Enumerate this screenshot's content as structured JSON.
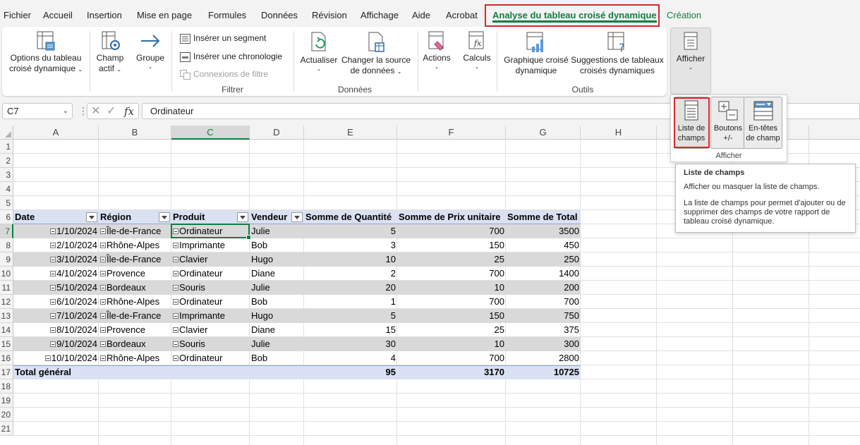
{
  "menu": {
    "tabs": [
      "Fichier",
      "Accueil",
      "Insertion",
      "Mise en page",
      "Formules",
      "Données",
      "Révision",
      "Affichage",
      "Aide",
      "Acrobat"
    ],
    "active_tab": "Analyse du tableau croisé dynamique",
    "extra_tab": "Création"
  },
  "ribbon": {
    "pivot_options_1": "Options du tableau",
    "pivot_options_2": "croisé dynamique",
    "active_field_1": "Champ",
    "active_field_2": "actif",
    "group": "Groupe",
    "insert_slicer": "Insérer un segment",
    "insert_timeline": "Insérer une chronologie",
    "filter_connections": "Connexions de filtre",
    "group_filter": "Filtrer",
    "refresh": "Actualiser",
    "change_source_1": "Changer la source",
    "change_source_2": "de données",
    "group_data": "Données",
    "actions": "Actions",
    "calculations": "Calculs",
    "pivot_chart_1": "Graphique croisé",
    "pivot_chart_2": "dynamique",
    "suggestions_1": "Suggestions de tableaux",
    "suggestions_2": "croisés dynamiques",
    "group_tools": "Outils",
    "show": "Afficher"
  },
  "show_dropdown": {
    "field_list_1": "Liste de",
    "field_list_2": "champs",
    "buttons_1": "Boutons",
    "buttons_2": "+/-",
    "headers_1": "En-têtes",
    "headers_2": "de champ",
    "group_label": "Afficher"
  },
  "tooltip": {
    "title": "Liste de champs",
    "line1": "Afficher ou masquer la liste de champs.",
    "line2": "La liste de champs pour permet d'ajouter ou de supprimer des champs de votre rapport de tableau croisé dynamique."
  },
  "formula_bar": {
    "name_box": "C7",
    "cancel": "✕",
    "enter": "✓",
    "fx": "fx",
    "content": "Ordinateur"
  },
  "sheet": {
    "columns": [
      "A",
      "B",
      "C",
      "D",
      "E",
      "F",
      "G",
      "H"
    ],
    "selected_column": "C",
    "rows": [
      "1",
      "2",
      "3",
      "4",
      "5",
      "6",
      "7",
      "8",
      "9",
      "10",
      "11",
      "12",
      "13",
      "14",
      "15",
      "16",
      "17",
      "18",
      "19",
      "20",
      "21"
    ],
    "selected_row": "7",
    "headers": [
      "Date",
      "Région",
      "Produit",
      "Vendeur",
      "Somme de Quantité",
      "Somme de Prix unitaire",
      "Somme de Total"
    ],
    "data": [
      [
        "1/10/2024",
        "Île-de-France",
        "Ordinateur",
        "Julie",
        "5",
        "700",
        "3500"
      ],
      [
        "2/10/2024",
        "Rhône-Alpes",
        "Imprimante",
        "Bob",
        "3",
        "150",
        "450"
      ],
      [
        "3/10/2024",
        "Île-de-France",
        "Clavier",
        "Hugo",
        "10",
        "25",
        "250"
      ],
      [
        "4/10/2024",
        "Provence",
        "Ordinateur",
        "Diane",
        "2",
        "700",
        "1400"
      ],
      [
        "5/10/2024",
        "Bordeaux",
        "Souris",
        "Julie",
        "20",
        "10",
        "200"
      ],
      [
        "6/10/2024",
        "Rhône-Alpes",
        "Ordinateur",
        "Bob",
        "1",
        "700",
        "700"
      ],
      [
        "7/10/2024",
        "Île-de-France",
        "Imprimante",
        "Hugo",
        "5",
        "150",
        "750"
      ],
      [
        "8/10/2024",
        "Provence",
        "Clavier",
        "Diane",
        "15",
        "25",
        "375"
      ],
      [
        "9/10/2024",
        "Bordeaux",
        "Souris",
        "Julie",
        "30",
        "10",
        "300"
      ],
      [
        "10/10/2024",
        "Rhône-Alpes",
        "Ordinateur",
        "Bob",
        "4",
        "700",
        "2800"
      ]
    ],
    "total_label": "Total général",
    "totals": [
      "95",
      "3170",
      "10725"
    ]
  },
  "colors": {
    "accent": "#107c41",
    "highlight": "#d42a2a",
    "pivot_header": "#d9e1f2",
    "pivot_band": "#d9d9d9"
  }
}
